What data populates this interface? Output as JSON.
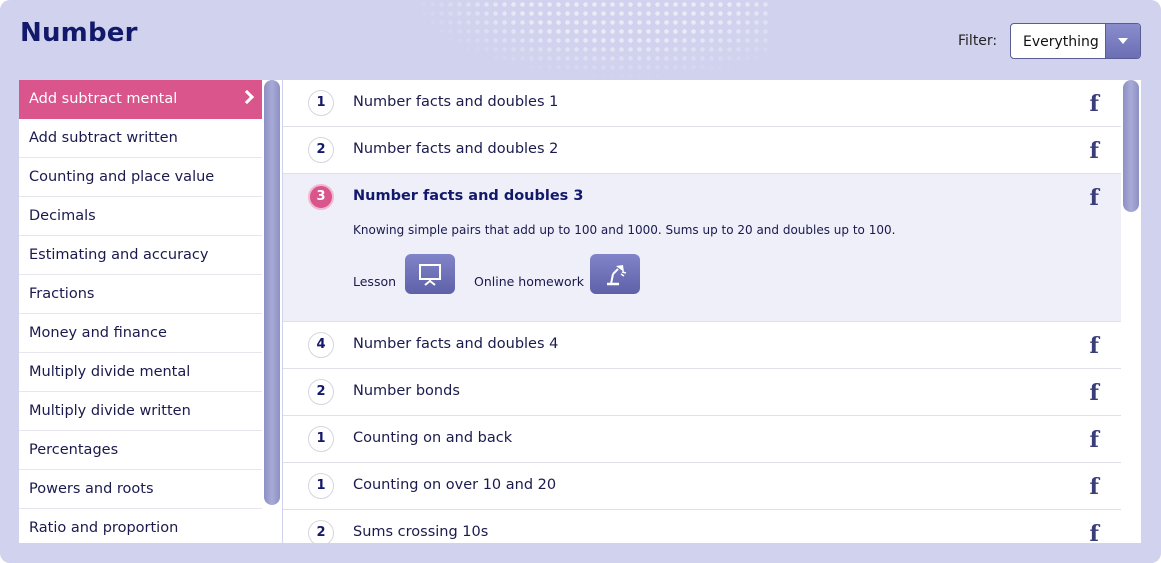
{
  "header": {
    "title": "Number",
    "filter_label": "Filter:",
    "filter_value": "Everything"
  },
  "sidebar": {
    "items": [
      {
        "label": "Add subtract mental",
        "active": true
      },
      {
        "label": "Add subtract written"
      },
      {
        "label": "Counting and place value"
      },
      {
        "label": "Decimals"
      },
      {
        "label": "Estimating and accuracy"
      },
      {
        "label": "Fractions"
      },
      {
        "label": "Money and finance"
      },
      {
        "label": "Multiply divide mental"
      },
      {
        "label": "Multiply divide written"
      },
      {
        "label": "Percentages"
      },
      {
        "label": "Powers and roots"
      },
      {
        "label": "Ratio and proportion"
      }
    ]
  },
  "list": {
    "rows": [
      {
        "level": "1",
        "title": "Number facts and doubles 1",
        "icon": "f"
      },
      {
        "level": "2",
        "title": "Number facts and doubles 2",
        "icon": "f"
      },
      {
        "level": "3",
        "title": "Number facts and doubles 3",
        "icon": "f",
        "description": "Knowing simple pairs that add up to 100 and 1000. Sums up to 20 and doubles up to 100.",
        "lesson_label": "Lesson",
        "homework_label": "Online homework"
      },
      {
        "level": "4",
        "title": "Number facts and doubles 4",
        "icon": "f"
      },
      {
        "level": "2",
        "title": "Number bonds",
        "icon": "f"
      },
      {
        "level": "1",
        "title": "Counting on and back",
        "icon": "f"
      },
      {
        "level": "1",
        "title": "Counting on over 10 and 20",
        "icon": "f"
      },
      {
        "level": "2",
        "title": "Sums crossing 10s",
        "icon": "f"
      }
    ]
  },
  "colors": {
    "accent_pink": "#d9558c",
    "navy": "#12186a",
    "frame": "#d0d2ee"
  }
}
